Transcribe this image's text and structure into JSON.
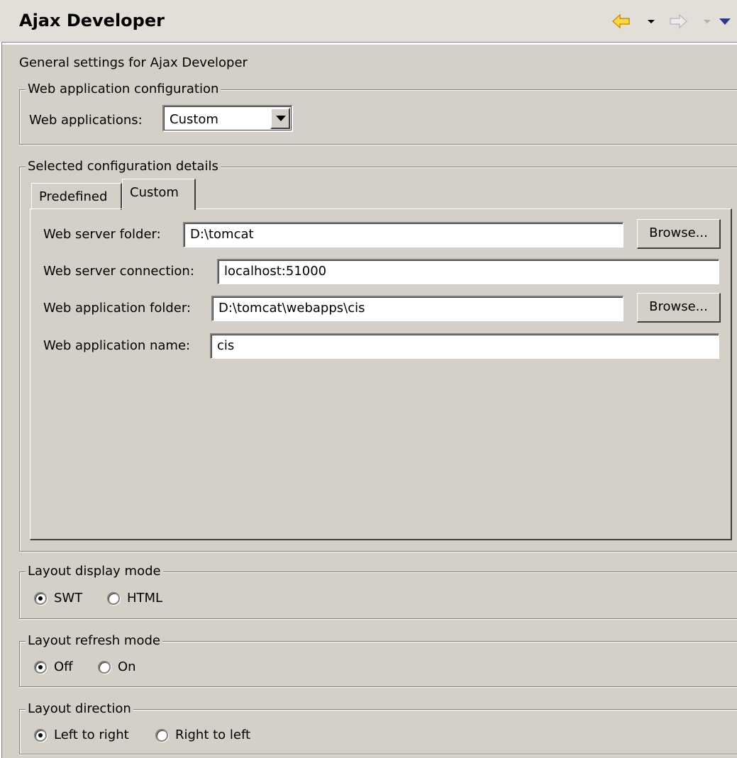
{
  "header": {
    "title": "Ajax Developer",
    "icons": [
      "back-arrow-icon",
      "forward-arrow-icon",
      "view-menu-icon"
    ]
  },
  "description": "General settings for Ajax Developer",
  "web_app_config": {
    "legend": "Web application configuration",
    "web_applications_label": "Web applications:",
    "web_applications_value": "Custom"
  },
  "details": {
    "legend": "Selected configuration details",
    "tabs": [
      {
        "label": "Predefined",
        "active": false
      },
      {
        "label": "Custom",
        "active": true
      }
    ],
    "fields": {
      "web_server_folder": {
        "label": "Web server folder:",
        "value": "D:\\tomcat"
      },
      "web_server_connection": {
        "label": "Web server connection:",
        "value": "localhost:51000"
      },
      "web_app_folder": {
        "label": "Web application folder:",
        "value": "D:\\tomcat\\webapps\\cis"
      },
      "web_app_name": {
        "label": "Web application name:",
        "value": "cis"
      }
    },
    "browse_label": "Browse..."
  },
  "layout_display": {
    "legend": "Layout display mode",
    "options": [
      {
        "label": "SWT",
        "checked": true
      },
      {
        "label": "HTML",
        "checked": false
      }
    ]
  },
  "layout_refresh": {
    "legend": "Layout refresh mode",
    "options": [
      {
        "label": "Off",
        "checked": true
      },
      {
        "label": "On",
        "checked": false
      }
    ]
  },
  "layout_direction": {
    "legend": "Layout direction",
    "options": [
      {
        "label": "Left to right",
        "checked": true
      },
      {
        "label": "Right to left",
        "checked": false
      }
    ]
  },
  "colors": {
    "background": "#d4d0c8",
    "header_background": "#e2dfd9",
    "back_arrow": "#f0c000",
    "view_menu": "#2c3a8c"
  }
}
